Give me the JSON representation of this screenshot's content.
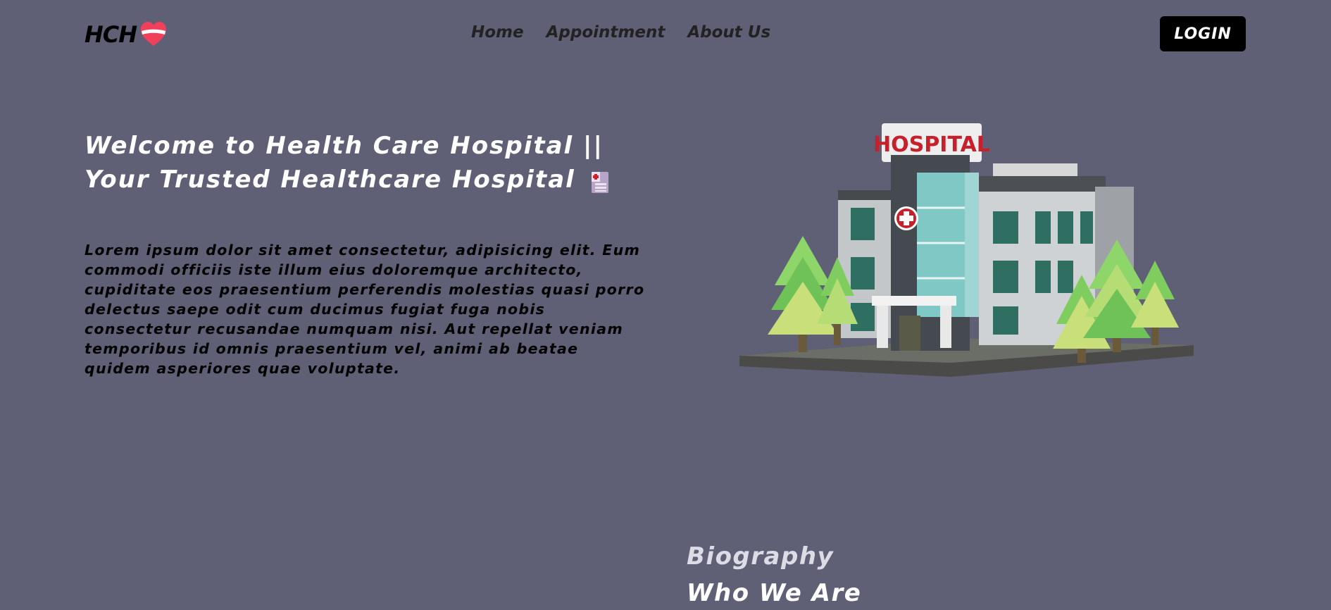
{
  "nav": {
    "logo_text": "HCH",
    "links": [
      {
        "label": "Home"
      },
      {
        "label": "Appointment"
      },
      {
        "label": "About Us"
      }
    ],
    "login_label": "LOGIN"
  },
  "hero": {
    "title": "Welcome to Health Care Hospital || Your Trusted Healthcare Hospital",
    "text": "Lorem ipsum dolor sit amet consectetur, adipisicing elit. Eum commodi officiis iste illum eius doloremque architecto, cupiditate eos praesentium perferendis molestias quasi porro delectus saepe odit cum ducimus fugiat fuga nobis consectetur recusandae numquam nisi. Aut repellat veniam temporibus id omnis praesentium vel, animi ab beatae quidem asperiores quae voluptate.",
    "image_sign": "HOSPITAL"
  },
  "biography": {
    "label": "Biography",
    "title": "Who We Are"
  },
  "icons": {
    "logo": "heart-icon",
    "title": "hospital-icon",
    "hero_image": "hospital-building-illustration"
  },
  "colors": {
    "background": "#5f5f75",
    "login_bg": "#000000",
    "heart": "#f0405a",
    "sign_text": "#c8202a"
  }
}
